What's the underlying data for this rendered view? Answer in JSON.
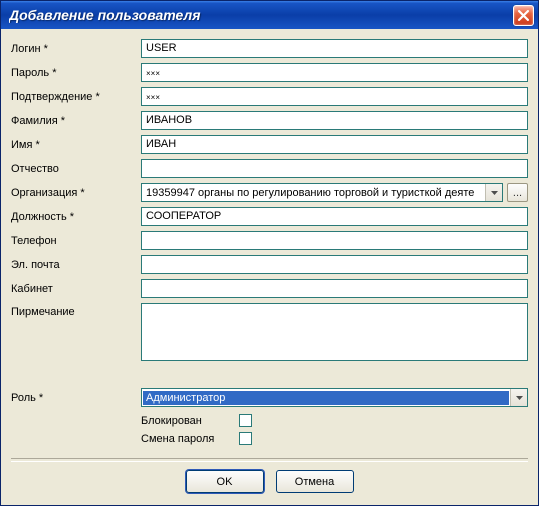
{
  "window": {
    "title": "Добавление пользователя"
  },
  "labels": {
    "login": "Логин *",
    "password": "Пароль *",
    "confirm": "Подтверждение *",
    "lastname": "Фамилия *",
    "firstname": "Имя *",
    "patronymic": "Отчество",
    "organization": "Организация *",
    "position": "Должность *",
    "phone": "Телефон",
    "email": "Эл. почта",
    "room": "Кабинет",
    "note": "Пирмечание",
    "role": "Роль *",
    "blocked": "Блокирован",
    "change_pw": "Смена пароля"
  },
  "values": {
    "login": "USER",
    "password_mask": "×××",
    "confirm_mask": "×××",
    "lastname": "ИВАНОВ",
    "firstname": "ИВАН",
    "patronymic": "",
    "organization": "19359947 органы по регулированию торговой и туристкой деяте",
    "position": "СООПЕРАТОР",
    "phone": "",
    "email": "",
    "room": "",
    "note": "",
    "role": "Администратор",
    "browse": "..."
  },
  "buttons": {
    "ok": "OK",
    "cancel": "Отмена"
  }
}
